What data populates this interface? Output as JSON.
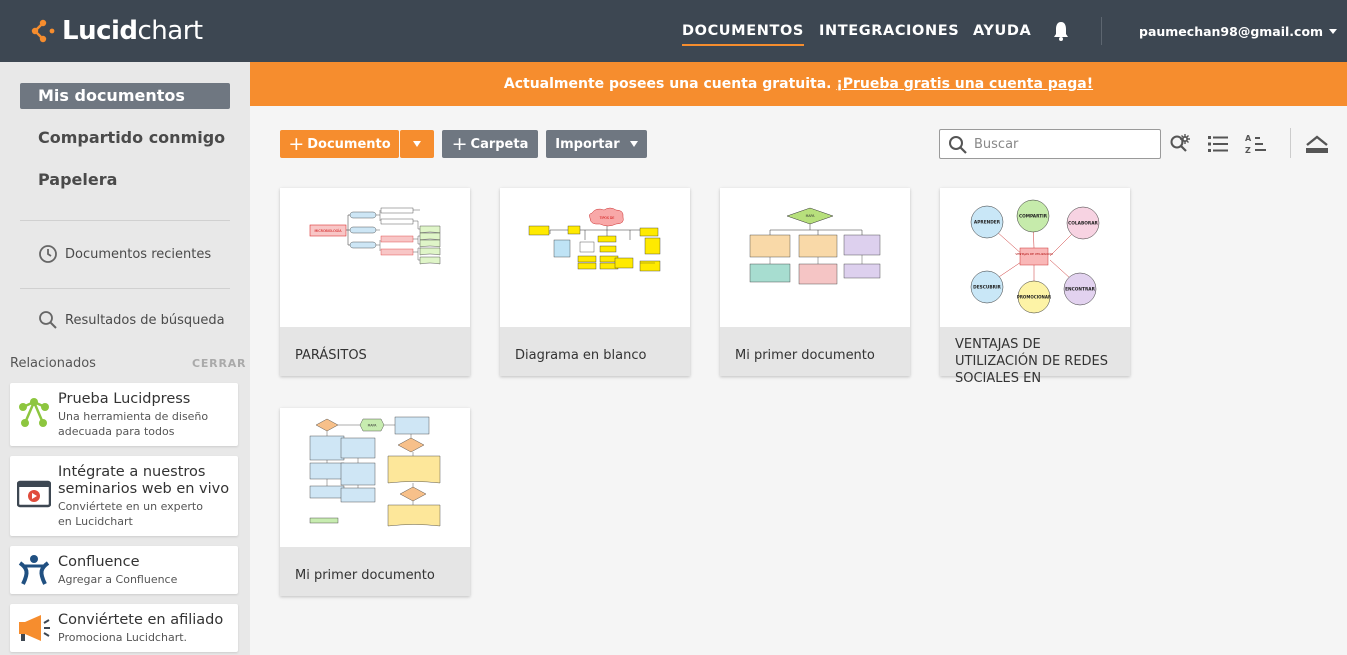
{
  "app": {
    "logo_bold": "Lucid",
    "logo_light": "chart",
    "colors": {
      "topbar": "#3d4752",
      "accent": "#f68d2e",
      "sidebar": "#e8e8e8",
      "active_item": "#6f7781"
    }
  },
  "nav": {
    "documents": "DOCUMENTOS",
    "integrations": "INTEGRACIONES",
    "help": "AYUDA",
    "user_email": "paumechan98@gmail.com"
  },
  "banner": {
    "text": "Actualmente posees una cuenta gratuita. ",
    "link": "¡Prueba gratis una cuenta paga!"
  },
  "sidebar": {
    "items": [
      {
        "label": "Mis documentos",
        "active": true
      },
      {
        "label": "Compartido conmigo"
      },
      {
        "label": "Papelera"
      }
    ],
    "recent": "Documentos recientes",
    "search_results": "Resultados de búsqueda",
    "related_heading": "Relacionados",
    "related_close": "CERRAR",
    "related": [
      {
        "title": "Prueba Lucidpress",
        "subtitle": "Una herramienta de diseño adecuada para todos",
        "icon": "lucidpress-icon"
      },
      {
        "title": "Intégrate a nuestros seminarios web en vivo",
        "subtitle": "Conviértete en un experto en Lucidchart",
        "icon": "webinar-icon"
      },
      {
        "title": "Confluence",
        "subtitle": "Agregar a Confluence",
        "icon": "confluence-icon"
      },
      {
        "title": "Conviértete en afiliado",
        "subtitle": "Promociona Lucidchart.",
        "icon": "megaphone-icon"
      }
    ]
  },
  "toolbar": {
    "new_document": "Documento",
    "new_folder": "Carpeta",
    "import": "Importar",
    "search_placeholder": "Buscar"
  },
  "documents": [
    {
      "title": "PARÁSITOS"
    },
    {
      "title": "Diagrama en blanco"
    },
    {
      "title": "Mi primer documento"
    },
    {
      "title": "VENTAJAS DE UTILIZACIÓN DE REDES SOCIALES EN"
    },
    {
      "title": "Mi primer documento"
    }
  ],
  "thumbnails": {
    "parasitos_root": "MICROBIOLOGÍA",
    "diagrama_root": "TIPOS DE",
    "primer_root": "MAPA",
    "ventajas_center": "VENTAJAS DE UTILIZACIÓN",
    "ventajas_nodes": [
      "APRENDER",
      "COMPARTIR",
      "COLABORAR",
      "DESCUBRIR",
      "PROMOCIONAR",
      "ENCONTRAR"
    ],
    "primer2_root": "MAPA"
  }
}
